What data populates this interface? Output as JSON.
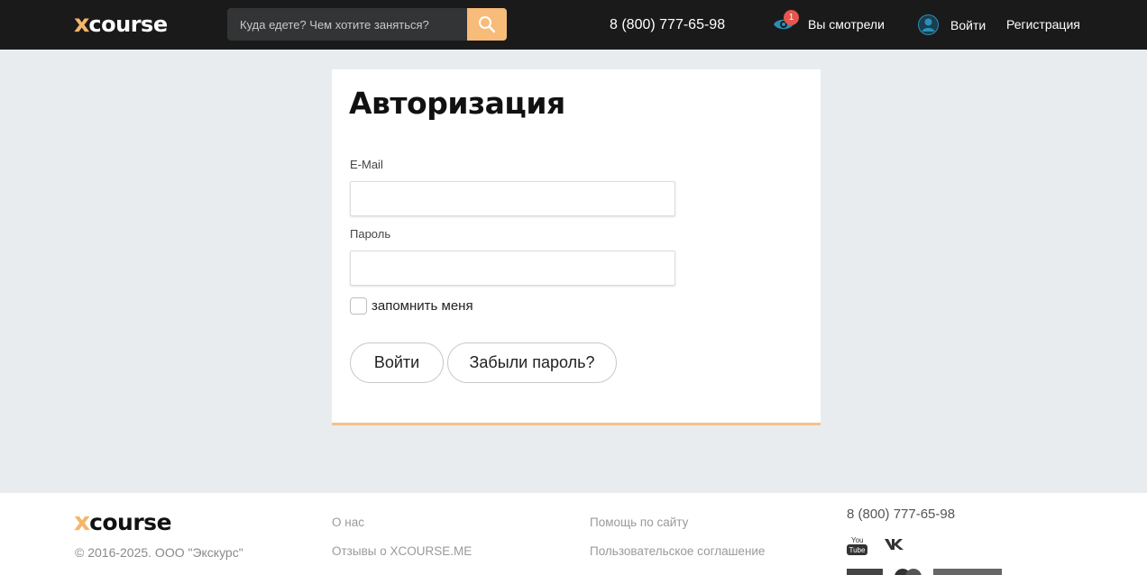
{
  "header": {
    "logo_x": "x",
    "logo_text": "course",
    "search_placeholder": "Куда едете? Чем хотите заняться?",
    "phone": "8 (800) 777-65-98",
    "viewed_label": "Вы смотрели",
    "viewed_count": "1",
    "login_label": "Войти",
    "register_label": "Регистрация"
  },
  "auth": {
    "title": "Авторизация",
    "email_label": "E-Mail",
    "email_value": "",
    "password_label": "Пароль",
    "password_value": "",
    "remember_label": "запомнить меня",
    "remember_checked": false,
    "login_button": "Войти",
    "forgot_button": "Забыли пароль?"
  },
  "footer": {
    "logo_x": "x",
    "logo_text": "course",
    "copyright": "© 2016-2025. ООО \"Экскурс\"",
    "links_col1": [
      "О нас",
      "Отзывы о XCOURSE.ME"
    ],
    "links_col2": [
      "Помощь по сайту",
      "Пользовательское соглашение"
    ],
    "phone": "8 (800) 777-65-98",
    "social": [
      "youtube-icon",
      "vk-icon"
    ]
  },
  "colors": {
    "accent": "#f7bb7a",
    "header_bg": "#1a1a1a",
    "page_bg": "#e9ecee",
    "badge": "#e4564f"
  }
}
